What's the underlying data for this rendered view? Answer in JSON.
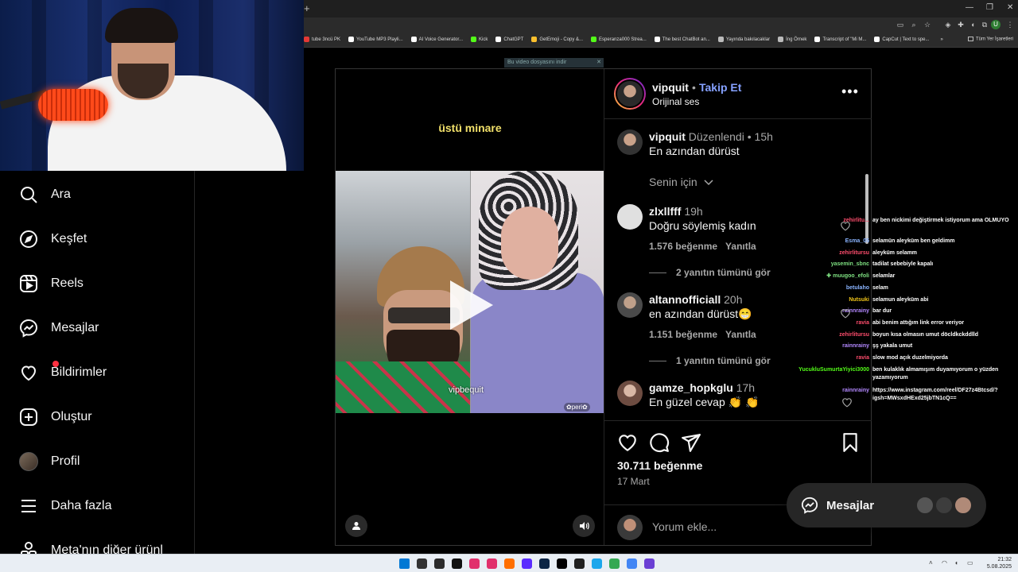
{
  "browser": {
    "new_tab_symbol": "+",
    "win_controls": [
      "—",
      "❐",
      "✕"
    ],
    "bookmarks": [
      {
        "label": "tube 3ncü PK",
        "color": "#e53935"
      },
      {
        "label": "YouTube MP3 Playli...",
        "color": "#ffffff"
      },
      {
        "label": "AI Voice Generator...",
        "color": "#ffffff"
      },
      {
        "label": "Kick",
        "color": "#53fc18"
      },
      {
        "label": "ChatGPT",
        "color": "#ffffff"
      },
      {
        "label": "GetEmoji - Copy &...",
        "color": "#fbc02d"
      },
      {
        "label": "Esperanza000 Strea...",
        "color": "#53fc18"
      },
      {
        "label": "The best ChatBot an...",
        "color": "#ffffff"
      },
      {
        "label": "Yayında bakılacaklar",
        "color": "#bbbbbb"
      },
      {
        "label": "İng Örnek",
        "color": "#bbbbbb"
      },
      {
        "label": "Transcript of \"Mi M...",
        "color": "#ffffff"
      },
      {
        "label": "CapCut | Text to spe...",
        "color": "#ffffff"
      }
    ],
    "bookmarks_more": "»",
    "all_bookmarks": "Tüm Yer İşaretleri",
    "profile_initial": "U",
    "download_banner": "Bu video dosyasını indir"
  },
  "sidebar": {
    "items": [
      {
        "label": "Ara",
        "icon": "search-icon"
      },
      {
        "label": "Keşfet",
        "icon": "compass-icon"
      },
      {
        "label": "Reels",
        "icon": "reels-icon"
      },
      {
        "label": "Mesajlar",
        "icon": "messenger-icon"
      },
      {
        "label": "Bildirimler",
        "icon": "heart-icon"
      },
      {
        "label": "Oluştur",
        "icon": "plus-square-icon"
      },
      {
        "label": "Profil",
        "icon": "avatar"
      },
      {
        "label": "Daha fazla",
        "icon": "menu-icon"
      },
      {
        "label": "Meta'nın diğer ürünl",
        "icon": "meta-apps-icon"
      }
    ]
  },
  "post": {
    "video": {
      "caption": "üstü minare",
      "watermark_left": "vipbequit",
      "watermark_right": "✿peri✿"
    },
    "header": {
      "username": "vipquit",
      "dot": "•",
      "follow": "Takip Et",
      "audio": "Orijinal ses",
      "more": "•••"
    },
    "caption": {
      "username": "vipquit",
      "edited": "Düzenlendi",
      "time": "15h",
      "text": "En azından dürüst"
    },
    "filter_label": "Senin için",
    "comments": [
      {
        "username": "zlxllfff",
        "time": "19h",
        "text": "Doğru söylemiş kadın",
        "likes": "1.576 beğenme",
        "reply": "Yanıtla",
        "replies": "2 yanıtın tümünü gör",
        "avatar_color": "#e0e0e0"
      },
      {
        "username": "altannofficiall",
        "time": "20h",
        "text": "en azından dürüst😁",
        "likes": "1.151 beğenme",
        "reply": "Yanıtla",
        "replies": "1 yanıtın tümünü gör",
        "avatar_color": "#4a4a4a"
      },
      {
        "username": "gamze_hopkglu",
        "time": "17h",
        "text": "En güzel cevap 👏 👏",
        "likes": "",
        "reply": "",
        "replies": "",
        "avatar_color": "#8d6e63"
      }
    ],
    "likes_count": "30.711 beğenme",
    "date": "17 Mart",
    "add_comment_placeholder": "Yorum ekle..."
  },
  "chat": [
    {
      "name": "zehirlitu...",
      "name_color": "#ff4d6d",
      "msg": "ay ben nickimi değiştirmek istiyorum ama OLMUYO"
    },
    {
      "name": "Esma_05",
      "name_color": "#8ab4ff",
      "msg": "selamün aleyküm ben geldimm"
    },
    {
      "name": "zehirlitursu",
      "name_color": "#ff4d6d",
      "msg": "aleyküm selamm"
    },
    {
      "name": "yasemin_sbnc",
      "name_color": "#7ee081",
      "msg": "tadilat sebebiyle kapalı"
    },
    {
      "name": "✚ muugoo_efoli",
      "name_color": "#7ee081",
      "msg": "selamlar"
    },
    {
      "name": "betulaho",
      "name_color": "#8ab4ff",
      "msg": "selam"
    },
    {
      "name": "Nutsuki",
      "name_color": "#f0c419",
      "msg": "selamun aleyküm abi"
    },
    {
      "name": "rainnrainy",
      "name_color": "#b388ff",
      "msg": "bar dur"
    },
    {
      "name": "ravia",
      "name_color": "#ff4d6d",
      "msg": "abi benim attığım link error veriyor"
    },
    {
      "name": "zehirlitursu",
      "name_color": "#ff4d6d",
      "msg": "boyun kısa olmasın umut döcldkckddlld"
    },
    {
      "name": "rainnrainy",
      "name_color": "#b388ff",
      "msg": "şş yakala umut"
    },
    {
      "name": "ravia",
      "name_color": "#ff4d6d",
      "msg": "slow mod açık duzelmiyorda"
    },
    {
      "name": "YucukluSumurtaYiyici3000",
      "name_color": "#53fc18",
      "msg": "ben kulaklık almamışım duyamıyorum o yüzden yazamıyorum"
    },
    {
      "name": "rainnrainy",
      "name_color": "#b388ff",
      "msg": "https://www.instagram.com/reel/DF27z4Btcsd/?igsh=MWsxdHExd25jbTN1cQ=="
    }
  ],
  "messages_pill": {
    "label": "Mesajlar"
  },
  "taskbar": {
    "time": "21:32",
    "date": "5.08.2025",
    "app_colors": [
      "#0078d4",
      "#333333",
      "#2b2b2b",
      "#111111",
      "#e1306c",
      "#e1306c",
      "#ff6f00",
      "#5b2cff",
      "#0b2545",
      "#000000",
      "#202020",
      "#1ca7ec",
      "#34a853",
      "#4285f4",
      "#6b3fd4"
    ]
  }
}
